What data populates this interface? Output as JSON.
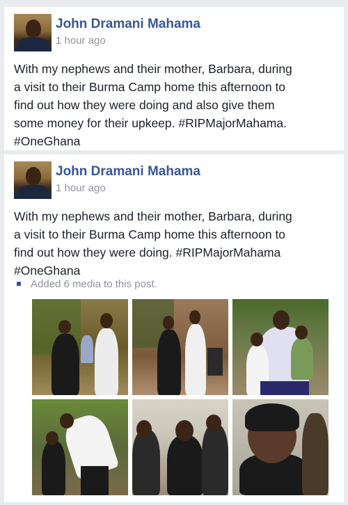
{
  "posts": [
    {
      "author": "John Dramani Mahama",
      "time": "1 hour ago",
      "lines": [
        "With my nephews and their mother, Barbara, during",
        "a visit to their Burma Camp home this afternoon to",
        "find out how they were doing and also give them",
        "some money for their upkeep. #RIPMajorMahama.",
        "#OneGhana"
      ]
    },
    {
      "author": "John Dramani Mahama",
      "time": "1 hour ago",
      "lines": [
        "With my nephews and their mother, Barbara, during",
        "a visit to their Burma Camp home this afternoon to",
        "find out how they were doing. #RIPMajorMahama",
        "#OneGhana"
      ],
      "media_note": "Added 6 media to this post."
    }
  ],
  "photos": [
    {
      "name": "photo-family-with-tree",
      "palette": [
        "#7a6a3a",
        "#4a6a2a",
        "#1a1a1a",
        "#e8e8e8"
      ]
    },
    {
      "name": "photo-family-standing-porch",
      "palette": [
        "#8a6a4a",
        "#3f5a2a",
        "#1a1a1a",
        "#f0f0f0"
      ]
    },
    {
      "name": "photo-hugging-children",
      "palette": [
        "#5a6a3a",
        "#3a6a2a",
        "#e0e0f0",
        "#2a2a6a"
      ]
    },
    {
      "name": "photo-bowing-greeting",
      "palette": [
        "#6a7a3a",
        "#3a5a2a",
        "#f4f4f4",
        "#1a1a1a"
      ]
    },
    {
      "name": "photo-women-seated",
      "palette": [
        "#c8c4b8",
        "#2a2a2a",
        "#4a3a2a",
        "#1a1a1a"
      ]
    },
    {
      "name": "photo-woman-closeup",
      "palette": [
        "#b8b4a8",
        "#1a1a1a",
        "#5a3a2a",
        "#2a2a2a"
      ]
    }
  ]
}
